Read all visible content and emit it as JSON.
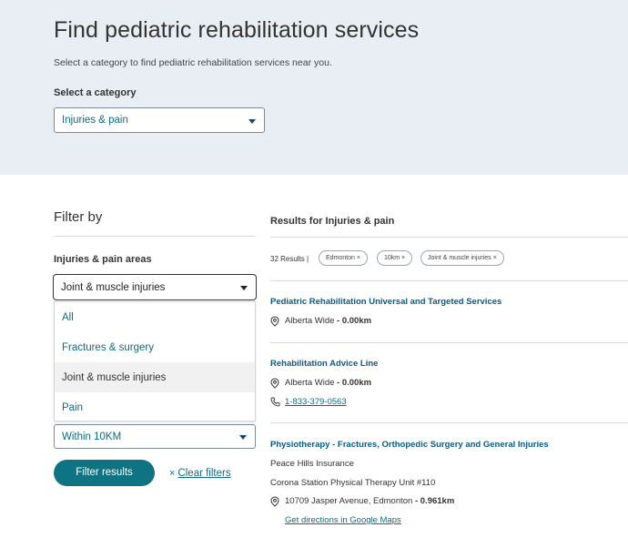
{
  "hero": {
    "title": "Find pediatric rehabilitation services",
    "subtitle": "Select a category to find pediatric rehabilitation services near you.",
    "category_label": "Select a category",
    "category_value": "Injuries & pain"
  },
  "filters": {
    "title": "Filter by",
    "areas_label": "Injuries & pain areas",
    "areas_value": "Joint & muscle injuries",
    "dropdown_options": [
      "All",
      "Fractures & surgery",
      "Joint & muscle injuries",
      "Pain"
    ],
    "selected_option": "Joint & muscle injuries",
    "distance_value": "Within 10KM",
    "filter_button": "Filter results",
    "clear_icon": "×",
    "clear_label": "Clear filters"
  },
  "results": {
    "title": "Results for Injuries & pain",
    "count": "32 Results |",
    "chips": [
      "Edmonton ×",
      "10km ×",
      "Joint & muscle injuries ×"
    ],
    "items": [
      {
        "title": "Pediatric Rehabilitation Universal and Targeted Services",
        "location": "Alberta Wide",
        "distance": " - 0.00km"
      },
      {
        "title": "Rehabilitation Advice Line",
        "location": "Alberta Wide",
        "distance": " - 0.00km",
        "phone": "1-833-379-0563"
      },
      {
        "title": "Physiotherapy - Fractures, Orthopedic Surgery and General Injuries",
        "org": "Peace Hills Insurance",
        "place": "Corona Station Physical Therapy Unit #110",
        "location": "10709 Jasper Avenue, Edmonton",
        "distance": " - 0.961km",
        "directions": "Get directions in Google Maps"
      }
    ]
  },
  "colors": {
    "hero_bg": "#e8eef3",
    "accent": "#0e7383",
    "link": "#0e6c7e",
    "title_link": "#0a5a86"
  },
  "icons": [
    "chevron-down-icon",
    "location-pin-icon",
    "phone-icon",
    "close-icon"
  ]
}
